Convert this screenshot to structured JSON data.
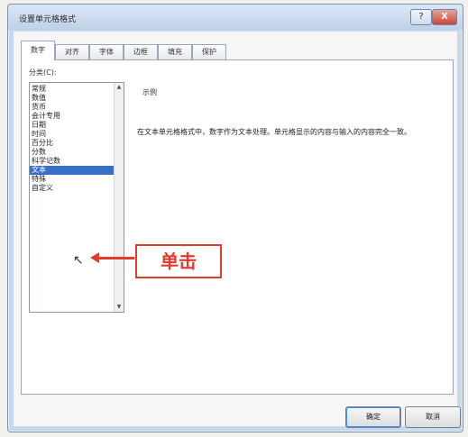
{
  "window": {
    "title": "设置单元格格式",
    "help_label": "?",
    "close_label": "X"
  },
  "tabs": [
    {
      "label": "数字",
      "active": true
    },
    {
      "label": "对齐"
    },
    {
      "label": "字体"
    },
    {
      "label": "边框"
    },
    {
      "label": "填充"
    },
    {
      "label": "保护"
    }
  ],
  "category": {
    "label": "分类(C):",
    "items": [
      "常规",
      "数值",
      "货币",
      "会计专用",
      "日期",
      "时间",
      "百分比",
      "分数",
      "科学记数",
      "文本",
      "特殊",
      "自定义"
    ],
    "selected_index": 9
  },
  "sample": {
    "label": "示例"
  },
  "description": "在文本单元格格式中，数字作为文本处理。单元格显示的内容与输入的内容完全一致。",
  "annotation": {
    "text": "单击",
    "color": "#e23a2e"
  },
  "buttons": {
    "ok": "确定",
    "cancel": "取消"
  }
}
